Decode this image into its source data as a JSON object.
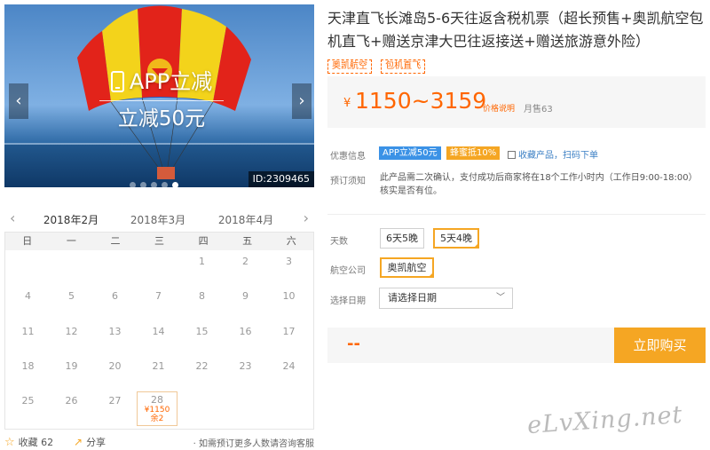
{
  "banner": {
    "promo_title": "APP立减",
    "promo_subtitle": "立减50元",
    "id_label": "ID:2309465",
    "prev_arrow": "‹",
    "next_arrow": "›",
    "dot_count": 5,
    "active_dot": 4
  },
  "calendar": {
    "prev_icon": "chevron-left-icon",
    "next_icon": "chevron-right-icon",
    "months": [
      "2018年2月",
      "2018年3月",
      "2018年4月"
    ],
    "active_month": 0,
    "weekdays": [
      "日",
      "一",
      "二",
      "三",
      "四",
      "五",
      "六"
    ],
    "first_weekday_index": 4,
    "days_in_month": 28,
    "priced_day": {
      "day": "28",
      "price": "¥1150",
      "remaining": "余2"
    }
  },
  "footer": {
    "fav_icon": "star-icon",
    "fav_label": "收藏 62",
    "share_icon": "share-icon",
    "share_label": "分享",
    "hint": "· 如需预订更多人数请咨询客服"
  },
  "product": {
    "title": "天津直飞长滩岛5-6天往返含税机票（超长预售+奥凯航空包机直飞+赠送京津大巴往返接送+赠送旅游意外险）",
    "tags": [
      "奥凯航空",
      "包机直飞"
    ],
    "price": {
      "currency": "¥",
      "range": "1150~3159",
      "explain": "价格说明",
      "sold": "月售63"
    },
    "promo": {
      "label": "优惠信息",
      "app_badge": "APP立减50元",
      "honey_badge": "蜂蜜抵10%",
      "link": "收藏产品，扫码下单"
    },
    "notice": {
      "label": "预订须知",
      "text": "此产品需二次确认，支付成功后商家将在18个工作小时内（工作日9:00-18:00）核实是否有位。"
    },
    "days": {
      "label": "天数",
      "options": [
        "6天5晚",
        "5天4晚"
      ],
      "selected": 1
    },
    "airline": {
      "label": "航空公司",
      "options": [
        "奥凯航空"
      ],
      "selected": 0
    },
    "date": {
      "label": "选择日期",
      "placeholder": "请选择日期"
    },
    "total": "--",
    "buy_label": "立即购买"
  },
  "watermark": "eLvXing.net",
  "colors": {
    "accent": "#f5a623",
    "price": "#ff6600",
    "link": "#3b7fc4",
    "app_badge": "#3b92e6"
  }
}
